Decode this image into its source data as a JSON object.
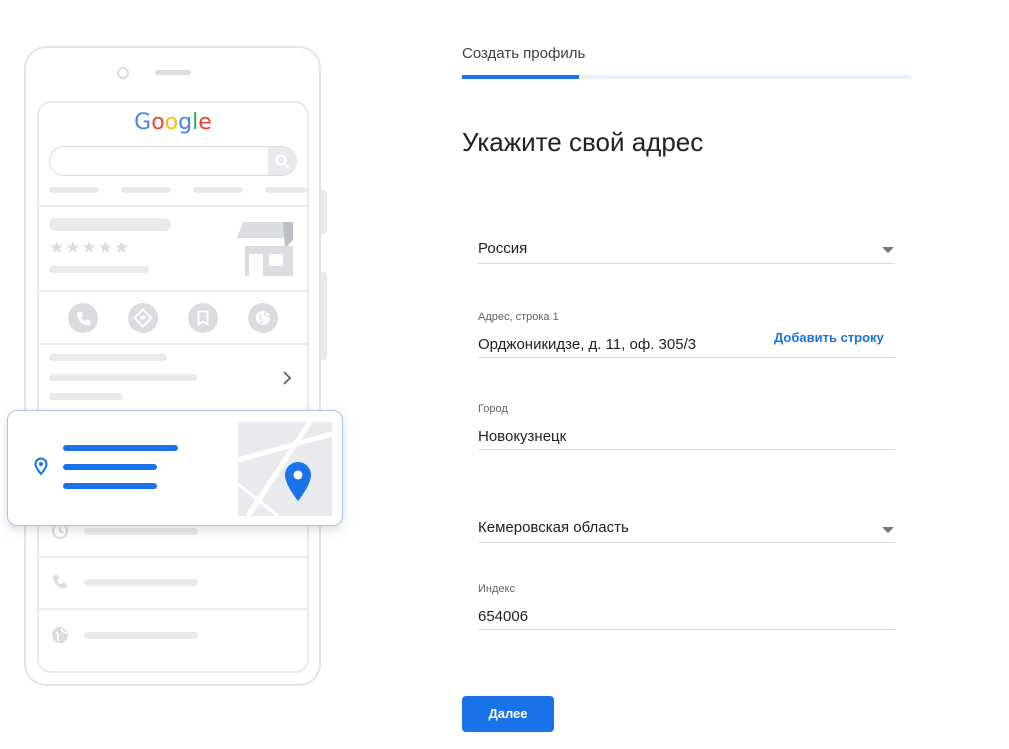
{
  "illustration": {
    "logo": {
      "letters": [
        {
          "char": "G",
          "color": "#4285F4"
        },
        {
          "char": "o",
          "color": "#EA4335"
        },
        {
          "char": "o",
          "color": "#FBBC05"
        },
        {
          "char": "g",
          "color": "#4285F4"
        },
        {
          "char": "l",
          "color": "#34A853"
        },
        {
          "char": "e",
          "color": "#EA4335"
        }
      ]
    },
    "rating_stars": "★★★★★",
    "icons": [
      "search-icon",
      "store-icon",
      "phone-icon",
      "directions-icon",
      "bookmark-icon",
      "globe-icon",
      "chevron-right-icon",
      "location-pin-icon",
      "map-pin-icon",
      "clock-icon",
      "globe-icon"
    ],
    "accent_color": "#1a73e8"
  },
  "header": {
    "step_title": "Создать профиль",
    "progress_fraction": 0.26
  },
  "main": {
    "heading": "Укажите свой адрес",
    "country": {
      "value": "Россия"
    },
    "address_line1": {
      "label": "Адрес, строка 1",
      "value": "Орджоникидзе, д. 11, оф. 305/3",
      "add_line_label": "Добавить строку"
    },
    "city": {
      "label": "Город",
      "value": "Новокузнецк"
    },
    "region": {
      "value": "Кемеровская область"
    },
    "postal_code": {
      "label": "Индекс",
      "value": "654006"
    },
    "next_button": "Далее"
  }
}
